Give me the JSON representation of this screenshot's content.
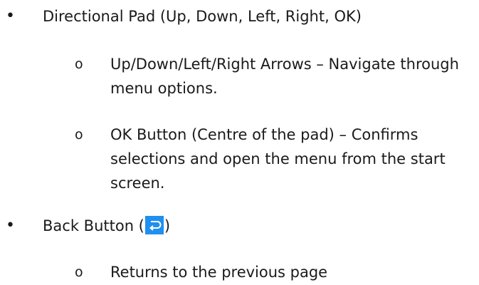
{
  "list": {
    "bullet": "•",
    "sub_bullet": "o",
    "item1": {
      "text": "Directional Pad (Up, Down, Left, Right, OK)",
      "sub1": "Up/Down/Left/Right Arrows – Navigate through menu options.",
      "sub2": "OK Button (Centre of the pad) – Confirms selections and open the menu from the start screen."
    },
    "item2": {
      "text_before": "Back Button (",
      "icon": "back-return-icon",
      "text_after": ")",
      "sub1": "Returns to the previous page"
    }
  },
  "colors": {
    "icon_bg": "#1f8ff0",
    "text": "#1a1a1a"
  }
}
